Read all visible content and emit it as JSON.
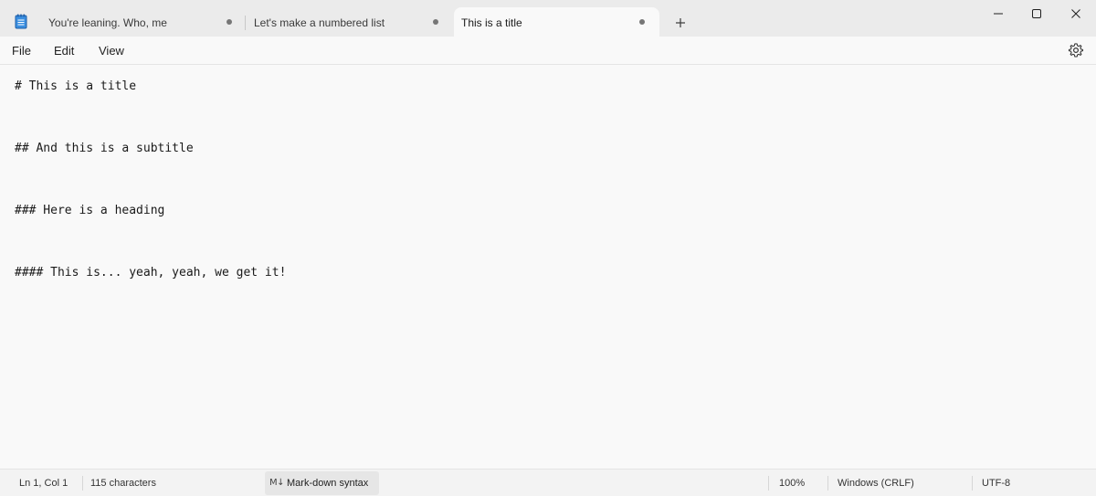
{
  "tabs": [
    {
      "label": "You're leaning. Who, me",
      "active": false
    },
    {
      "label": "Let's make a numbered list",
      "active": false
    },
    {
      "label": "This is a title",
      "active": true
    }
  ],
  "new_tab_icon": "plus-icon",
  "window_controls": [
    "minimize-icon",
    "maximize-icon",
    "close-icon"
  ],
  "menu": {
    "items": [
      "File",
      "Edit",
      "View"
    ],
    "settings_icon": "gear-icon"
  },
  "editor": {
    "lines": [
      "# This is a title",
      "## And this is a subtitle",
      "### Here is a heading",
      "#### This is... yeah, yeah, we get it!"
    ]
  },
  "status": {
    "position": "Ln 1, Col 1",
    "char_count": "115 characters",
    "format": "Mark-down syntax",
    "zoom": "100%",
    "line_endings": "Windows (CRLF)",
    "encoding": "UTF-8"
  },
  "colors": {
    "titlebar_bg": "#ebebeb",
    "editor_bg": "#f9f9f9",
    "statusbar_bg": "#f3f3f3",
    "app_icon_blue": "#2b7cd3"
  }
}
